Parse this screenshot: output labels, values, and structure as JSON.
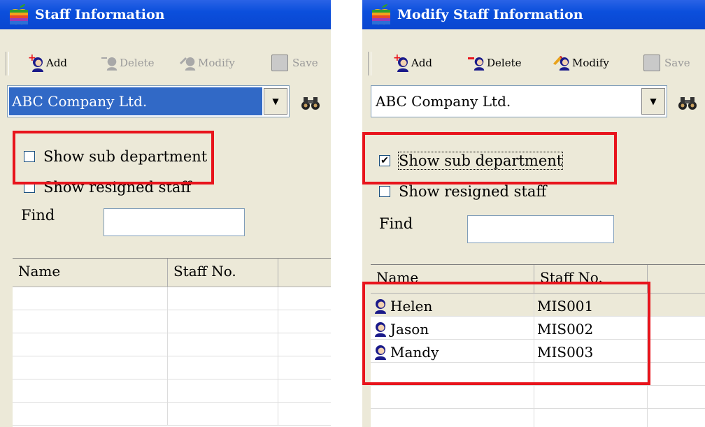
{
  "left_window": {
    "title": "Staff Information",
    "toolbar": {
      "add": "Add",
      "delete": "Delete",
      "modify": "Modify",
      "save": "Save"
    },
    "company_select": "ABC Company Ltd.",
    "show_sub_department": {
      "label": "Show sub department",
      "checked": false
    },
    "show_resigned_staff": {
      "label": "Show resigned staff",
      "checked": false
    },
    "find_label": "Find",
    "find_value": "",
    "columns": [
      "Name",
      "Staff No."
    ],
    "rows": []
  },
  "right_window": {
    "title": "Modify Staff Information",
    "toolbar": {
      "add": "Add",
      "delete": "Delete",
      "modify": "Modify",
      "save": "Save"
    },
    "company_select": "ABC Company Ltd.",
    "show_sub_department": {
      "label": "Show sub department",
      "checked": true
    },
    "show_resigned_staff": {
      "label": "Show resigned staff",
      "checked": false
    },
    "find_label": "Find",
    "find_value": "",
    "columns": [
      "Name",
      "Staff No."
    ],
    "rows": [
      {
        "name": "Helen",
        "staff_no": "MIS001"
      },
      {
        "name": "Jason",
        "staff_no": "MIS002"
      },
      {
        "name": "Mandy",
        "staff_no": "MIS003"
      }
    ]
  },
  "colors": {
    "titlebar": "#0a46d0",
    "highlight": "#e8141c",
    "selection": "#3169c6"
  }
}
